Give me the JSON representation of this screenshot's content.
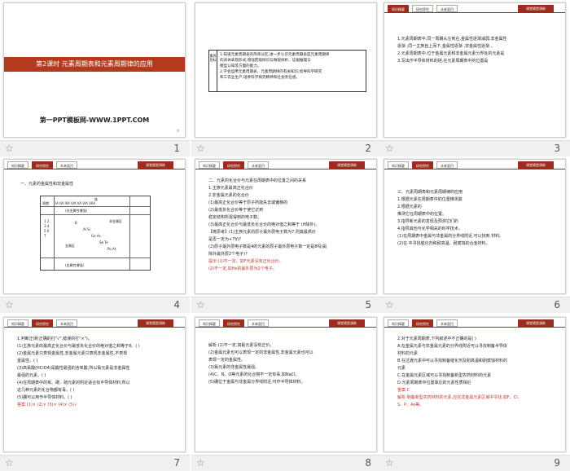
{
  "tabs": {
    "t1": "知识精要",
    "t2": "研究探究",
    "t3": "本来面目",
    "badge": "课堂随堂演练"
  },
  "slides": [
    {
      "num": "1",
      "title": "第2课时 元素周期表和元素周期律的应用",
      "site": "第一PPT模板网-WWW.1PPT.COM"
    },
    {
      "num": "2",
      "side": "素养目标",
      "goals": [
        "1.知道元素周期表的简单分区,进一步认识元素周期表是元素周期律",
        "的具体表现形式,增强宏观辨识与微观探析、证据推理与",
        "模型认知等方面的能力。",
        "2.学会运用元素周期表、元素周期律的有关知识,指导科学研究",
        "和工农业生产,培养科学探究精神和社会责任感。"
      ]
    },
    {
      "num": "3",
      "lines": [
        "1.元素周期表中,同一周期从左到右,金属性逐渐减弱,非金属性",
        "逐渐     ;同一主族自上而下,金属性逐渐     ,非金属性逐渐     。",
        "2.元素周期表中,位于金属元素和非金属元素分界处的元素是",
        "3.写出作半导体材料的硅,在元素周期表中的位置是"
      ]
    },
    {
      "num": "4",
      "heading": "一、元素的金属性和非金属性",
      "diag": {
        "cap": "族",
        "top": "IA IIA IIIA IVA VA VIA VIIA",
        "m": "(非金属性增强)",
        "b": "(金属性增强)",
        "p": "周期",
        "nums": "1 2 3 4 5 6 7",
        "e1": "B",
        "e2": "Al Si",
        "e3": "Ge As",
        "e4": "Sb Te",
        "e5": "Po At",
        "n1": "非金属区",
        "n2": "金属区"
      }
    },
    {
      "num": "5",
      "lines": [
        "二、元素的化合价与元素在周期表中的位置之间的关系",
        "1.主族元素最高正化合价",
        "2.非金属元素的化合价",
        "(1)最高正化合价等于原子所能失去或偏移的",
        "(2)最低负化合价等于使它达到",
        "稳定结构所需得到的电子数。",
        "(3)最高正化合价与最低负化合价的绝对值之和等于     (H除外)。",
        "【微思考】(1)主族元素的原子最外层电子数为7,则其最高价",
        "是否一定为+7价?",
        "(2)原子最外层电子数是4的元素的原子最外层电子数一定是8吗(氦",
        "除外最外层2个电子)?"
      ],
      "hints": [
        "提示:(1)不一定。如F元素没有正化合价。",
        "(2)不一定,如He的最外层为2个电子。"
      ]
    },
    {
      "num": "6",
      "lines": [
        "三、元素周期表和元素周期律的应用",
        "1.根据元素在周期表中的位置推测其",
        "2.根据元素的",
        "推测它在周期表中的位置。",
        "3.指导新元素的发现及预测它们的",
        "4.指导其他与化学相关的科学技术。",
        "(1)在周期表中金属与非金属的分界线附近,可以找到     材料。",
        "(2)在     中寻找催化剂和耐高温、耐腐蚀的合金材料。"
      ]
    },
    {
      "num": "7",
      "lines": [
        "1.判断正误(正确的打\"√\",错误的打\"×\")。",
        "(1)主族元素的最高正化合价与最低负化合价的绝对值之和等于8。(   )",
        "(2)金属元素只表现金属性,非金属元素只表现非金属性,不表现",
        "金属性。(   )",
        "(3)高氯酸(HClO4)是酸性最强的含氧酸,所以氯元素是非金属性",
        "最强的元素。(   )",
        "(4)在周期表中的氧、碳、硫元素的附近适合找半导体材料,所以",
        "这几种元素的化合物都有毒。(   )",
        "(5)硼可以用作半导体材料。(   )"
      ],
      "ans": "答案:(1)×  (2)×  (3)×  (4)×  (5)√"
    },
    {
      "num": "8",
      "lines": [
        "解析:(1)不一定,如氟元素没有正价。",
        "(2)金属元素也可以表现一定的非金属性,非金属元素也可以",
        "表现一定的金属性。",
        "(3)氟元素的非金属性最强。",
        "(4)C、N、O等元素的化合物不一定有毒,如NaCl。",
        "(5)硼位于金属与非金属分界线附近,可作半导体材料。"
      ]
    },
    {
      "num": "9",
      "lines": [
        "2.对于元素周期表,下列叙述中不正确的是(   )",
        "A.在金属元素与非金属元素的分界线附近可以寻找制备半导体",
        "材料的元素",
        "B.在过渡元素中可以寻找制备催化剂及耐高温和耐腐蚀材料的",
        "元素",
        "C.在金属元素区域可以寻找制备新型农药材料的元素",
        "D.元素周期表中位置靠近的元素性质相近"
      ],
      "ans": "答案:C",
      "exp": [
        "解析:制备新型农药材料的元素,应在非金属元素区域中寻找,如F、Cl、",
        "S、P、As等。"
      ]
    }
  ],
  "colors": {
    "accent": "#9b2d1f",
    "band": "#b33a1f"
  }
}
